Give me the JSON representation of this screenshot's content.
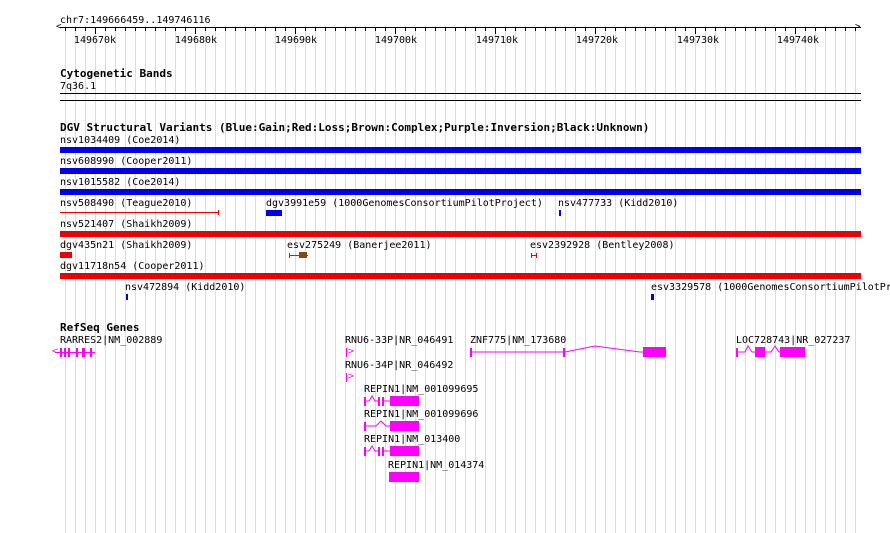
{
  "ruler": {
    "location": "chr7:149666459..149746116",
    "ticks": [
      "149670k",
      "149680k",
      "149690k",
      "149700k",
      "149710k",
      "149720k",
      "149730k",
      "149740k"
    ]
  },
  "cytobands": {
    "title": "Cytogenetic Bands",
    "band": "7q36.1"
  },
  "dgv": {
    "title": "DGV Structural Variants (Blue:Gain;Red:Loss;Brown:Complex;Purple:Inversion;Black:Unknown)",
    "labels": {
      "nsv1034409": "nsv1034409 (Coe2014)",
      "nsv608990": "nsv608990 (Cooper2011)",
      "nsv1015582": "nsv1015582 (Coe2014)",
      "nsv508490": "nsv508490 (Teague2010)",
      "dgv3991e59": "dgv3991e59 (1000GenomesConsortiumPilotProject)",
      "nsv477733": "nsv477733 (Kidd2010)",
      "nsv521407": "nsv521407 (Shaikh2009)",
      "dgv435n21": "dgv435n21 (Shaikh2009)",
      "esv275249": "esv275249 (Banerjee2011)",
      "esv2392928": "esv2392928 (Bentley2008)",
      "dgv11718n54": "dgv11718n54 (Cooper2011)",
      "nsv472894": "nsv472894 (Kidd2010)",
      "esv3329578": "esv3329578 (1000GenomesConsortiumPilotPr"
    }
  },
  "refseq": {
    "title": "RefSeq Genes",
    "labels": {
      "rarres2": "RARRES2|NM_002889",
      "rnu6_33p": "RNU6-33P|NR_046491",
      "znf775": "ZNF775|NM_173680",
      "loc728743": "LOC728743|NR_027237",
      "rnu6_34p": "RNU6-34P|NR_046492",
      "repin1_a": "REPIN1|NM_001099695",
      "repin1_b": "REPIN1|NM_001099696",
      "repin1_c": "REPIN1|NM_013400",
      "repin1_d": "REPIN1|NM_014374"
    }
  },
  "colors": {
    "gain": "#0000ee",
    "loss": "#ee0000",
    "complex": "#8b4513",
    "gene": "#ff00ff",
    "grid": "#cfe0ec"
  }
}
